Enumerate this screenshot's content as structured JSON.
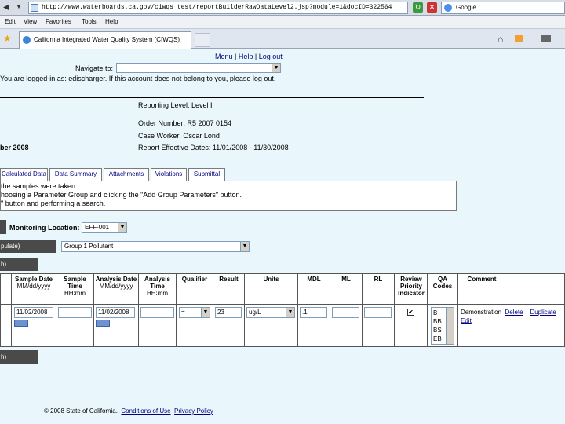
{
  "browser": {
    "url": "http://www.waterboards.ca.gov/ciwqs_test/reportBuilderRawDataLevel2.jsp?module=1&docID=322564",
    "search_text": "Google",
    "menu": [
      "Edit",
      "View",
      "Favorites",
      "Tools",
      "Help"
    ],
    "tab_title": "California Integrated Water Quality System (CIWQS)"
  },
  "page": {
    "top_links": [
      "Menu",
      "Help",
      "Log out"
    ],
    "navigate_label": "Navigate to:",
    "logged_in_msg": "You are logged-in as: edischarger. If this account does not belong to you, please log out.",
    "reporting_level": "Reporting Level: Level I",
    "order_number": "Order Number: R5 2007 0154",
    "case_worker": "Case Worker: Oscar Lond",
    "effective_dates": "Report Effective Dates: 11/01/2008 - 11/30/2008",
    "period_fragment": "ber 2008",
    "tabs": [
      "Calculated Data",
      "Data Summary",
      "Attachments",
      "Violations",
      "Submittal"
    ],
    "instructions": [
      "the samples were taken.",
      "hoosing a Parameter Group and clicking the \"Add Group Parameters\" button.",
      "\" button and performing a search."
    ],
    "monitoring_label": "Monitoring Location:",
    "monitoring_value": "EFF-001",
    "section1": "pulate)",
    "param_group": "Group 1 Pollutant",
    "section2": "h)",
    "section3": "h)",
    "footer_copyright": "© 2008 State of California.",
    "footer_conditions": "Conditions of Use",
    "footer_privacy": "Privacy Policy"
  },
  "table": {
    "headers": {
      "sample_date": "Sample Date",
      "sample_date_fmt": "MM/dd/yyyy",
      "sample_time": "Sample Time",
      "sample_time_fmt": "HH:mm",
      "analysis_date": "Analysis Date",
      "analysis_date_fmt": "MM/dd/yyyy",
      "analysis_time": "Analysis Time",
      "analysis_time_fmt": "HH:mm",
      "qualifier": "Qualifier",
      "result": "Result",
      "units": "Units",
      "mdl": "MDL",
      "ml": "ML",
      "rl": "RL",
      "review": "Review Priority Indicator",
      "qa": "QA Codes",
      "comment": "Comment"
    },
    "row": {
      "sample_date": "11/02/2008",
      "sample_time": "",
      "analysis_date": "11/02/2008",
      "analysis_time": "",
      "qualifier": "=",
      "result": "23",
      "units": "ug/L",
      "mdl": ".1",
      "ml": "",
      "rl": "",
      "review_checked": "✔",
      "qa_codes": [
        "B",
        "BB",
        "BS",
        "EB"
      ],
      "action_demo": "Demonstration",
      "action_delete": "Delete",
      "action_duplicate": "Duplicate",
      "action_edit": "Edit"
    }
  }
}
